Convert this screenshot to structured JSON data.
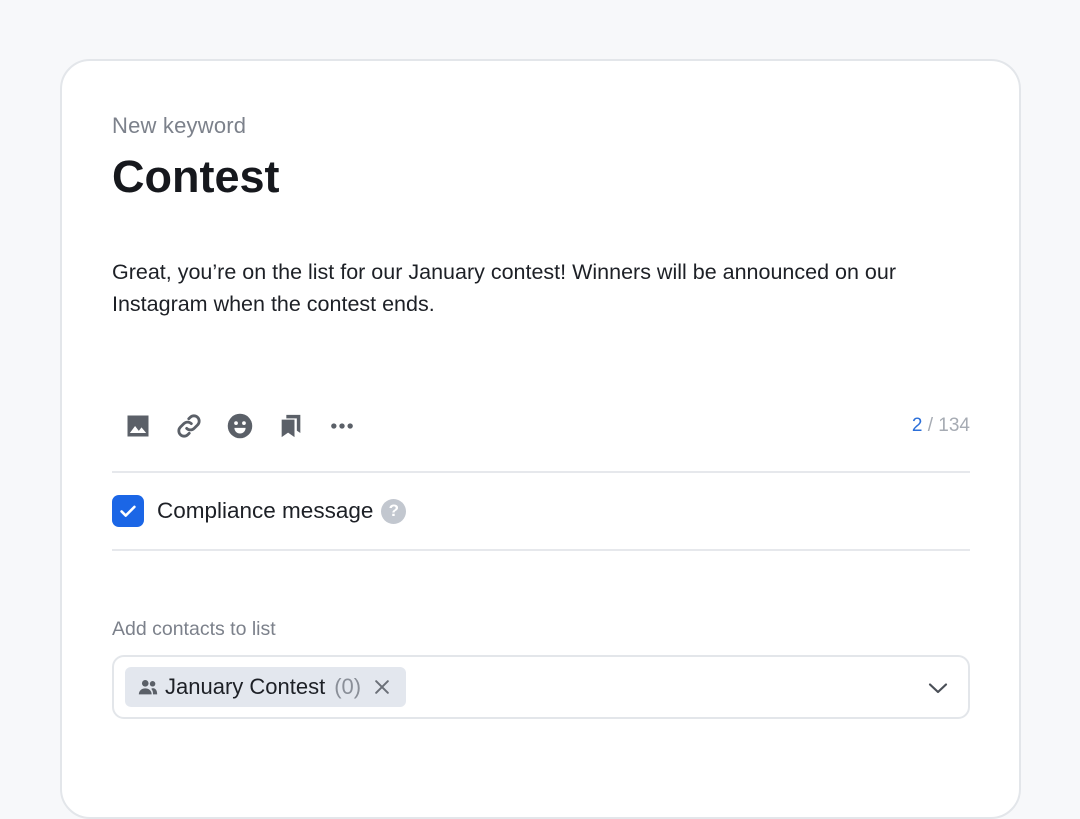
{
  "header": {
    "eyebrow": "New keyword",
    "title": "Contest"
  },
  "message": {
    "text": "Great, you’re on the list for our January contest! Winners will be announced on our Instagram when the contest ends."
  },
  "toolbar": {
    "icons": [
      "image-icon",
      "link-icon",
      "emoji-icon",
      "bookmarks-icon",
      "more-icon"
    ],
    "counter_current": "2",
    "counter_separator": "/",
    "counter_total": "134"
  },
  "compliance": {
    "checked": true,
    "label": "Compliance message",
    "help_glyph": "?"
  },
  "contacts": {
    "label": "Add contacts to list",
    "chip_label": "January Contest",
    "chip_count": "(0)"
  },
  "colors": {
    "accent": "#1b66e6",
    "counter_accent": "#2b6fd9",
    "chip_bg": "#e3e7ee",
    "muted_text": "#7c818b"
  }
}
